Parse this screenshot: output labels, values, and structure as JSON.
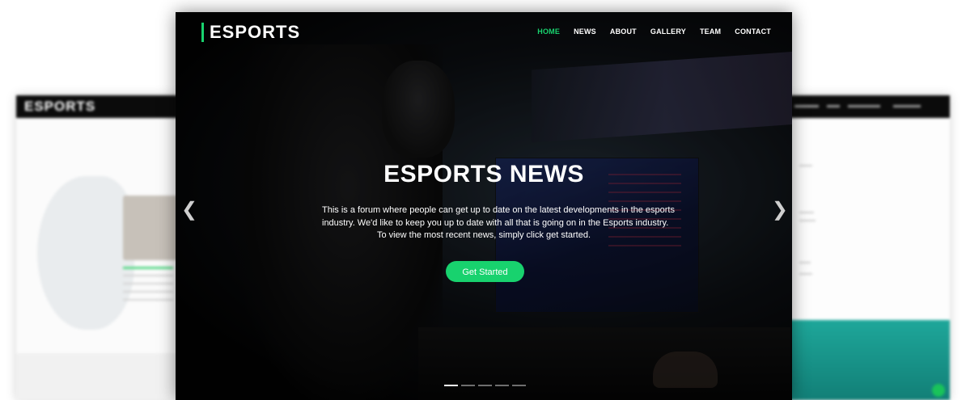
{
  "background_left": {
    "logo": "ESPORTS"
  },
  "hero": {
    "brand": "ESPORTS",
    "nav": [
      {
        "label": "HOME",
        "active": true
      },
      {
        "label": "NEWS",
        "active": false
      },
      {
        "label": "ABOUT",
        "active": false
      },
      {
        "label": "GALLERY",
        "active": false
      },
      {
        "label": "TEAM",
        "active": false
      },
      {
        "label": "CONTACT",
        "active": false
      }
    ],
    "title": "ESPORTS NEWS",
    "description_lines": [
      "This is a forum where people can get up to date on the latest developments in the esports",
      "industry. We'd like to keep you up to date with all that is going on in the Esports industry.",
      "To view the most recent news, simply click get started."
    ],
    "cta_label": "Get Started",
    "carousel": {
      "slides": 5,
      "active_index": 0
    },
    "icons": {
      "prev": "chevron-left-icon",
      "next": "chevron-right-icon"
    }
  },
  "colors": {
    "accent": "#18d26e",
    "hero_bg": "#060606",
    "teal_section": "#1ea79a"
  }
}
